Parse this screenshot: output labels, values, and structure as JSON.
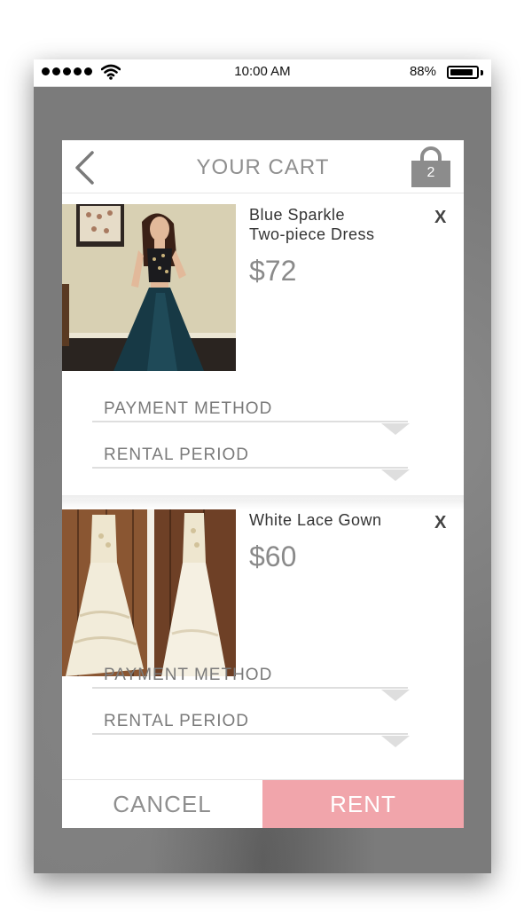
{
  "app": {
    "accent_color": "#f1a5ab",
    "background_color": "#7b7b7b"
  },
  "status_bar": {
    "time": "10:00 AM",
    "battery_percent_text": "88%",
    "battery_level": 0.88,
    "signal_bars": 5,
    "wifi_icon": "wifi-icon",
    "battery_icon": "battery-icon"
  },
  "header": {
    "title": "YOUR CART",
    "back_icon": "chevron-left-icon",
    "bag_icon": "shopping-bag-icon",
    "bag_count": "2"
  },
  "cart": {
    "items": [
      {
        "name": "Blue Sparkle\nTwo-piece Dress",
        "price": "$72",
        "remove_label": "X",
        "payment_method_label": "PAYMENT METHOD",
        "rental_period_label": "RENTAL PERIOD"
      },
      {
        "name": "White Lace Gown",
        "price": "$60",
        "remove_label": "X",
        "payment_method_label": "PAYMENT METHOD",
        "rental_period_label": "RENTAL PERIOD"
      }
    ]
  },
  "actions": {
    "cancel_label": "CANCEL",
    "rent_label": "RENT"
  }
}
